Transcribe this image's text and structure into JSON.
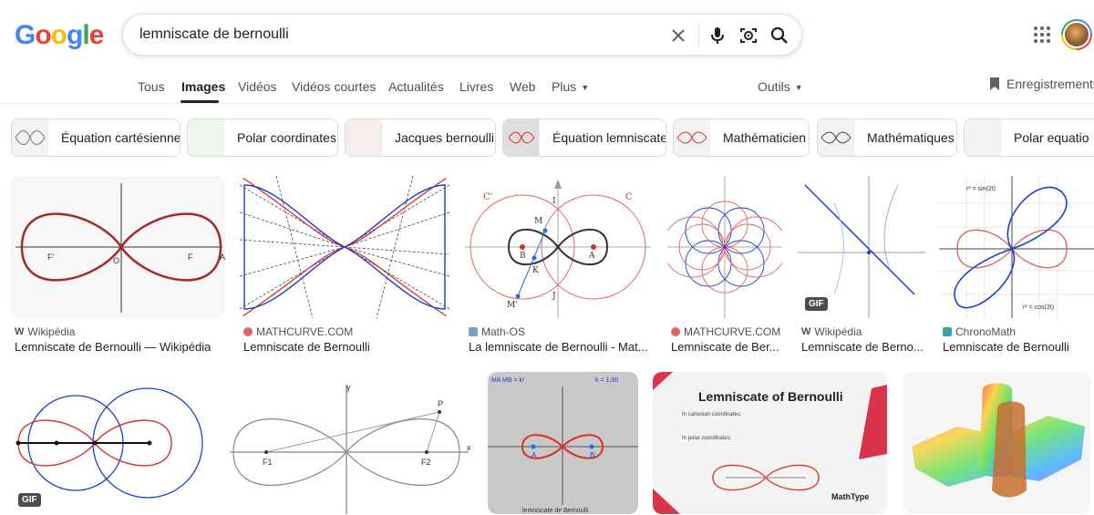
{
  "logo": {
    "letters": [
      "G",
      "o",
      "o",
      "g",
      "l",
      "e"
    ],
    "colors": [
      "#4285f4",
      "#ea4335",
      "#fbbc05",
      "#4285f4",
      "#34a853",
      "#ea4335"
    ]
  },
  "search": {
    "query": "lemniscate de bernoulli"
  },
  "icons": {
    "clear": "close-icon",
    "voice": "microphone-icon",
    "lens": "camera-icon",
    "search": "search-icon",
    "apps": "apps-grid-icon",
    "saves": "bookmark-icon"
  },
  "nav": {
    "tabs": [
      "Tous",
      "Images",
      "Vidéos",
      "Vidéos courtes",
      "Actualités",
      "Livres",
      "Web",
      "Plus"
    ],
    "active": "Images",
    "tools": "Outils",
    "saves": "Enregistrements"
  },
  "chips": [
    "Équation cartésienne",
    "Polar coordinates",
    "Jacques bernoulli",
    "Équation lemniscate",
    "Mathématicien",
    "Mathématiques",
    "Polar equatio"
  ],
  "results_row1": [
    {
      "source": "Wikipédia",
      "title": "Lemniscate de Bernoulli — Wikipédia"
    },
    {
      "source": "MATHCURVE.COM",
      "title": "Lemniscate de Bernoulli"
    },
    {
      "source": "Math-OS",
      "title": "La lemniscate de Bernoulli - Mat..."
    },
    {
      "source": "MATHCURVE.COM",
      "title": "Lemniscate de Ber..."
    },
    {
      "source": "Wikipédia",
      "title": "Lemniscate de Berno...",
      "badge": "GIF"
    },
    {
      "source": "ChronoMath",
      "title": "Lemniscate de Bernoulli"
    }
  ],
  "results_row2": [
    {
      "badge": "GIF"
    },
    {},
    {
      "caption_left": "MA MB = k²",
      "caption_right": "k = 1.00",
      "bottom": "lemniscate de Bernoulli"
    },
    {
      "heading": "Lemniscate of Bernoulli",
      "sub1": "In cartesian coordinates:",
      "sub2": "In polar coordinates:",
      "brand": "MathType"
    },
    {}
  ],
  "diagram_labels": {
    "wiki": [
      "F'",
      "O",
      "F",
      "A"
    ],
    "mathos": [
      "C'",
      "C",
      "I",
      "M",
      "B",
      "A",
      "K",
      "J",
      "M'"
    ],
    "bern2": [
      "y",
      "x",
      "P",
      "F1",
      "F2"
    ],
    "cinder": [
      "A",
      "B"
    ],
    "chrono": [
      "r² = sin(2t)",
      "r² = cos(2t)"
    ]
  },
  "colors": {
    "accent": "#1a73e8",
    "curve_red": "#d93025",
    "curve_blue": "#1a3fd0"
  }
}
